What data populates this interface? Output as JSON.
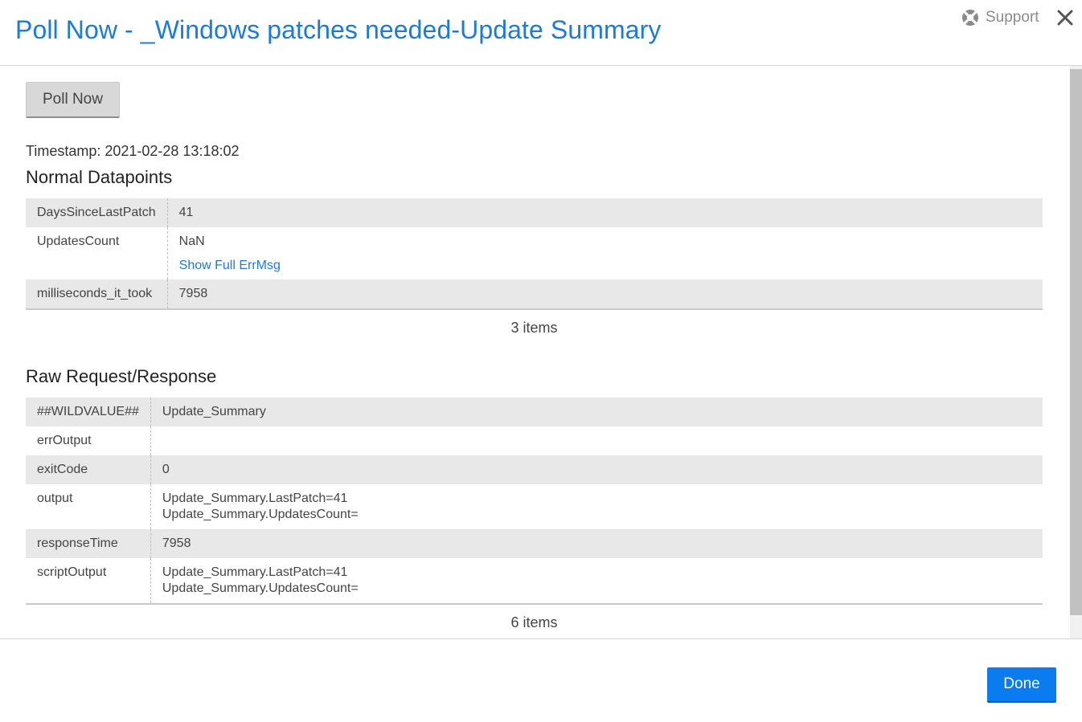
{
  "header": {
    "title": "Poll Now - _Windows patches needed-Update Summary",
    "support_label": "Support",
    "accent_color": "#1a7bd8"
  },
  "poll_button": {
    "label": "Poll Now"
  },
  "timestamp": "Timestamp: 2021-02-28 13:18:02",
  "normal_datapoints": {
    "title": "Normal Datapoints",
    "rows": [
      {
        "key": "DaysSinceLastPatch",
        "value": "41"
      },
      {
        "key": "UpdatesCount",
        "value": "NaN",
        "link": "Show Full ErrMsg"
      },
      {
        "key": "milliseconds_it_took",
        "value": "7958"
      }
    ],
    "count": "3 items"
  },
  "raw": {
    "title": "Raw Request/Response",
    "rows": [
      {
        "key": "##WILDVALUE##",
        "value": "Update_Summary"
      },
      {
        "key": "errOutput",
        "value": ""
      },
      {
        "key": "exitCode",
        "value": "0"
      },
      {
        "key": "output",
        "line1": "Update_Summary.LastPatch=41",
        "line2": "Update_Summary.UpdatesCount="
      },
      {
        "key": "responseTime",
        "value": "7958"
      },
      {
        "key": "scriptOutput",
        "line1": "Update_Summary.LastPatch=41",
        "line2": "Update_Summary.UpdatesCount="
      }
    ],
    "count": "6 items"
  },
  "footer": {
    "done_label": "Done",
    "done_color": "#0a7cf0"
  },
  "icons": {
    "support": "lifebuoy-icon",
    "close": "close-icon"
  }
}
